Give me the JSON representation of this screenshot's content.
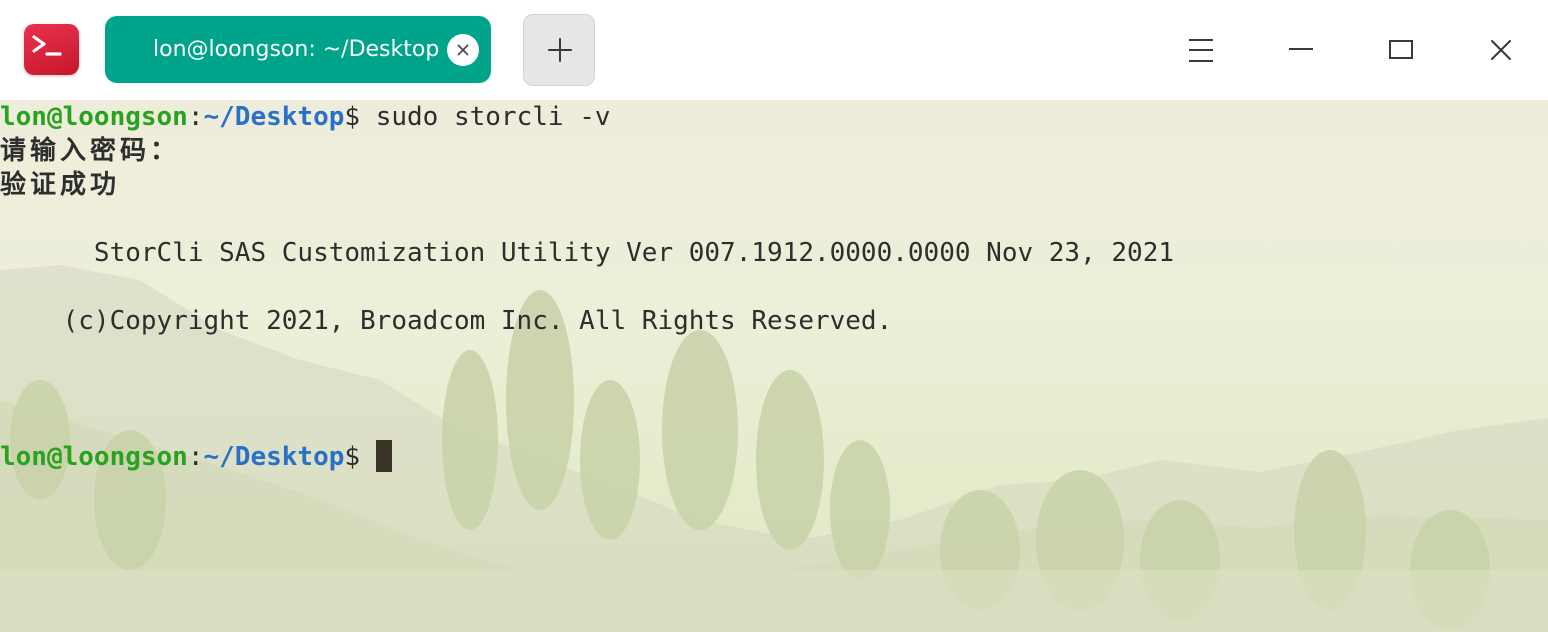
{
  "window": {
    "app_icon": "terminal-icon",
    "tab": {
      "title": "lon@loongson: ~/Desktop",
      "close_icon": "close-icon"
    },
    "new_tab_icon": "plus-icon",
    "controls": {
      "menu_icon": "hamburger-menu-icon",
      "minimize_icon": "minimize-icon",
      "maximize_icon": "maximize-icon",
      "close_icon": "close-icon"
    },
    "colors": {
      "tab_active": "#00a48a",
      "app_icon": "#d42038",
      "prompt_user": "#29a31f",
      "prompt_path": "#2870c8"
    }
  },
  "terminal": {
    "prompt_user": "lon@loongson",
    "prompt_sep": ":",
    "prompt_path": "~/Desktop",
    "prompt_dollar": "$",
    "command": " sudo storcli -v",
    "password_prompt": "请输入密码：",
    "auth_success": "验证成功",
    "version_line": "      StorCli SAS Customization Utility Ver 007.1912.0000.0000 Nov 23, 2021",
    "copyright_line": "    (c)Copyright 2021, Broadcom Inc. All Rights Reserved."
  }
}
